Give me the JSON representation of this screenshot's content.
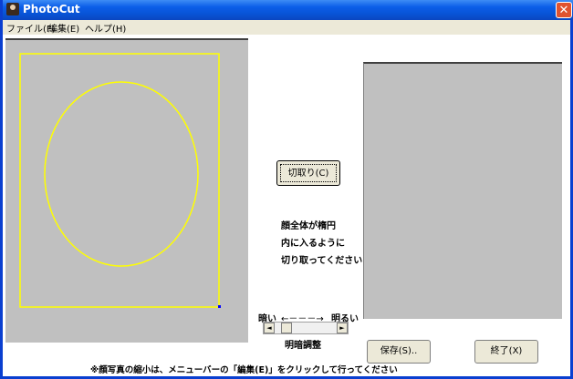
{
  "window": {
    "title": "PhotoCut"
  },
  "menu": [
    "ファイル(F)",
    "編集(E)",
    "ヘルプ(H)"
  ],
  "buttons": {
    "cut": "切取り(C)",
    "save": "保存(S)..",
    "end": "終了(X)"
  },
  "instruction": {
    "line1": "顔全体が楕円",
    "line2": "内に入るように",
    "line3": "切り取ってください"
  },
  "brightness": {
    "dark": "暗い",
    "arrow": "←－－－→",
    "bright": "明るい",
    "label": "明暗調整",
    "left_arrow": "◄",
    "right_arrow": "►",
    "value": 0.12
  },
  "footer_note": "※顔写真の縮小は、メニューバーの「編集(E)」をクリックして行ってください",
  "colors": {
    "selection_frame": "#ffff00",
    "canvas": "#c0c0c0"
  }
}
